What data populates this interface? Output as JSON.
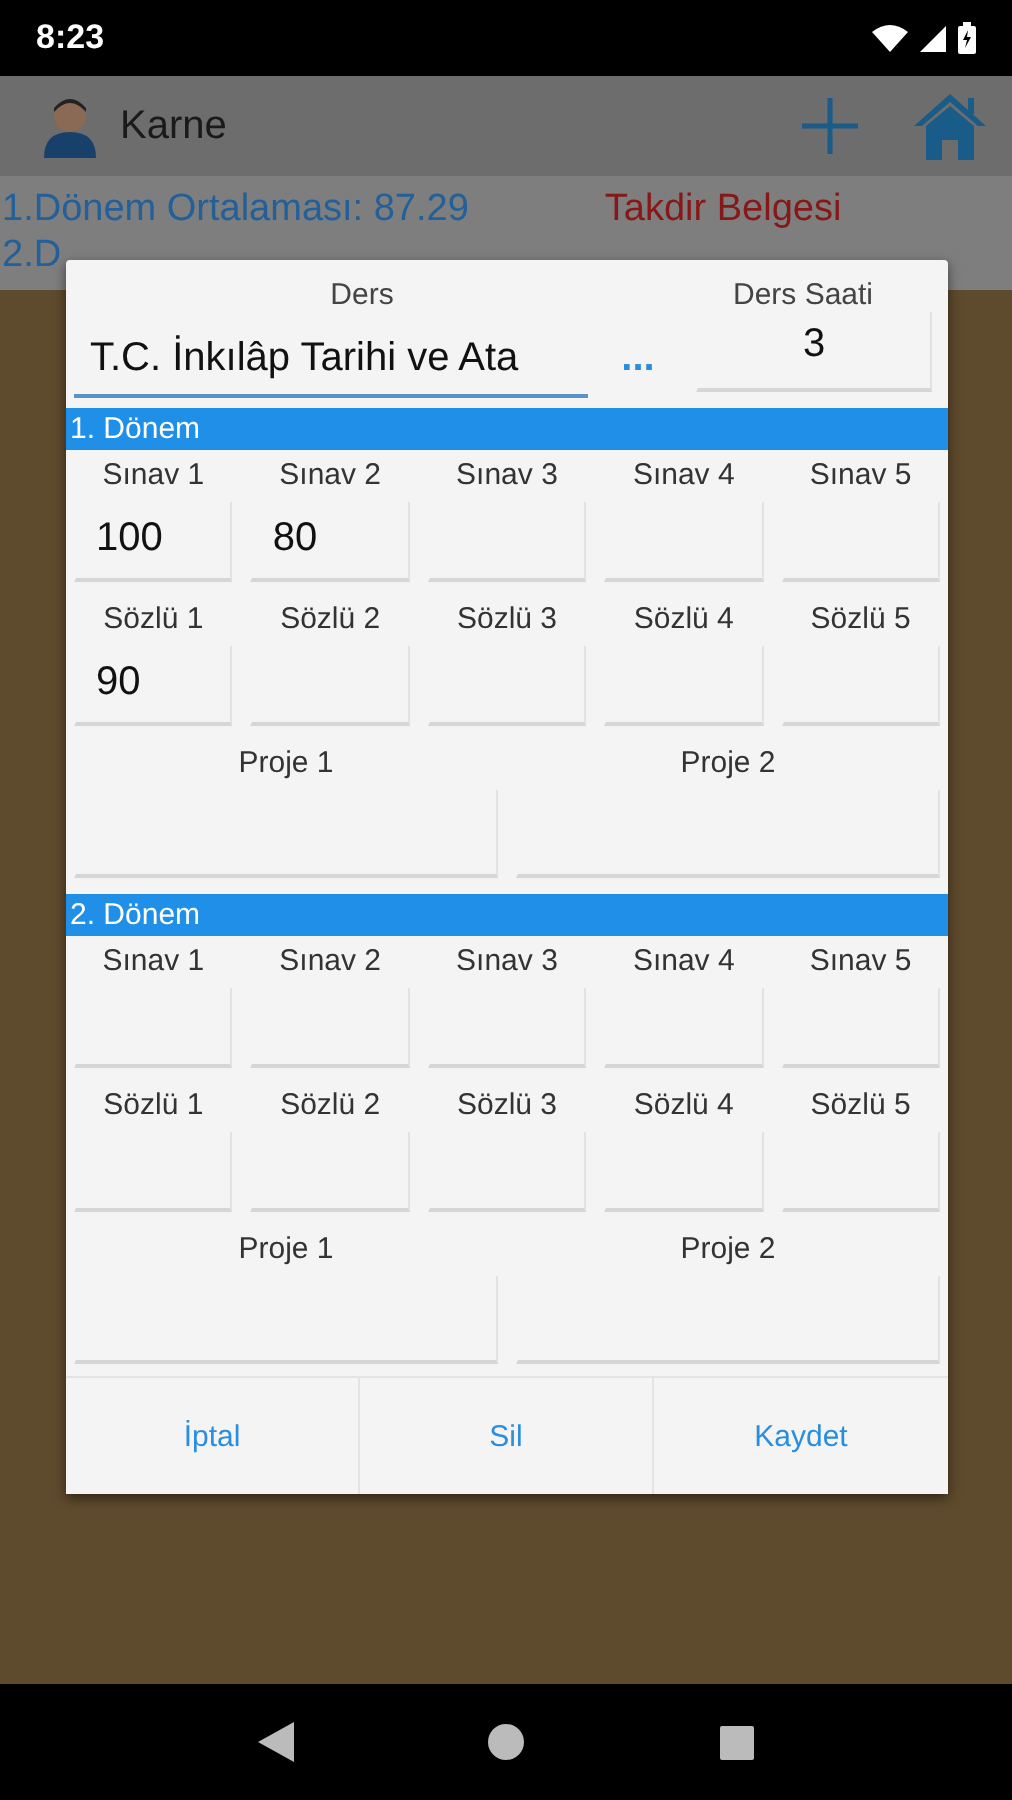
{
  "status_bar": {
    "time": "8:23"
  },
  "app_bar": {
    "title": "Karne"
  },
  "summary": [
    {
      "kind": "average",
      "text": "1.Dönem Ortalaması: 87.29"
    },
    {
      "kind": "award",
      "text": "Takdir Belgesi"
    },
    {
      "kind": "average",
      "text": "2.D"
    }
  ],
  "dialog": {
    "course_label": "Ders",
    "course_value": "T.C. İnkılâp Tarihi ve Ata",
    "more_button": "...",
    "hours_label": "Ders Saati",
    "hours_value": "3",
    "periods": [
      {
        "title": "1. Dönem",
        "exams": [
          {
            "label": "Sınav 1",
            "value": "100"
          },
          {
            "label": "Sınav 2",
            "value": "80"
          },
          {
            "label": "Sınav 3"
          },
          {
            "label": "Sınav 4"
          },
          {
            "label": "Sınav 5"
          }
        ],
        "orals": [
          {
            "label": "Sözlü 1",
            "value": "90"
          },
          {
            "label": "Sözlü 2"
          },
          {
            "label": "Sözlü 3"
          },
          {
            "label": "Sözlü 4"
          },
          {
            "label": "Sözlü 5"
          }
        ],
        "projects": [
          {
            "label": "Proje 1"
          },
          {
            "label": "Proje 2"
          }
        ]
      },
      {
        "title": "2. Dönem",
        "exams": [
          {
            "label": "Sınav 1"
          },
          {
            "label": "Sınav 2"
          },
          {
            "label": "Sınav 3"
          },
          {
            "label": "Sınav 4"
          },
          {
            "label": "Sınav 5"
          }
        ],
        "orals": [
          {
            "label": "Sözlü 1"
          },
          {
            "label": "Sözlü 2"
          },
          {
            "label": "Sözlü 3"
          },
          {
            "label": "Sözlü 4"
          },
          {
            "label": "Sözlü 5"
          }
        ],
        "projects": [
          {
            "label": "Proje 1"
          },
          {
            "label": "Proje 2"
          }
        ]
      }
    ],
    "buttons": [
      "İptal",
      "Sil",
      "Kaydet"
    ]
  }
}
